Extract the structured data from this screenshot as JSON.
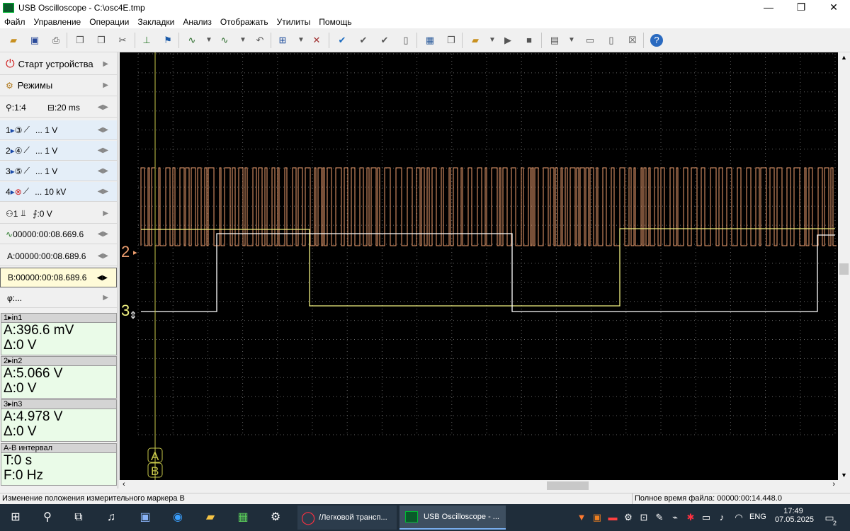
{
  "window": {
    "title": "USB Oscilloscope - C:\\osc4E.tmp",
    "min": "—",
    "max": "❐",
    "close": "✕"
  },
  "menu": [
    "Файл",
    "Управление",
    "Операции",
    "Закладки",
    "Анализ",
    "Отображать",
    "Утилиты",
    "Помощь"
  ],
  "sidebar": {
    "start": "Старт устройства",
    "modes": "Режимы",
    "zoom": ":1:4",
    "timebase": ":20 ms",
    "channels": [
      {
        "num": "1",
        "src": "③",
        "scale": "... 1 V"
      },
      {
        "num": "2",
        "src": "④",
        "scale": "... 1 V"
      },
      {
        "num": "3",
        "src": "⑤",
        "scale": "... 1 V"
      },
      {
        "num": "4",
        "src": "⊗",
        "scale": "... 10 kV"
      }
    ],
    "trigger_ch": "1",
    "trigger_level": ":0 V",
    "trigger_time": "00000:00:08.669.6",
    "marker_a": "A:00000:00:08.689.6",
    "marker_b": "B:00000:00:08.689.6",
    "phase": "φ:..."
  },
  "measurements": [
    {
      "head": "1▸in1",
      "a": "A:396.6 mV",
      "d": "Δ:0 V"
    },
    {
      "head": "2▸in2",
      "a": "A:5.066 V",
      "d": "Δ:0 V"
    },
    {
      "head": "3▸in3",
      "a": "A:4.978 V",
      "d": "Δ:0 V"
    }
  ],
  "interval": {
    "head": "A-B интервал",
    "t": "T:0 s",
    "f": "F:0 Hz"
  },
  "scope": {
    "ch2_marker": "2",
    "ch3_marker": "3",
    "cursor_a": "A",
    "cursor_b": "B",
    "colors": {
      "ch2": "#f0a070",
      "ch3": "#ffffff",
      "ch1": "#f0f080",
      "cursor": "#c8c84a",
      "grid": "#555555"
    }
  },
  "status": {
    "left": "Изменение положения измерительного маркера В",
    "right": "Полное время файла: 00000:00:14.448.0"
  },
  "taskbar": {
    "app1": "/Легковой трансп...",
    "app2": "USB Oscilloscope - ...",
    "lang": "ENG",
    "time": "17:49",
    "date": "07.05.2025",
    "notif": "2"
  }
}
